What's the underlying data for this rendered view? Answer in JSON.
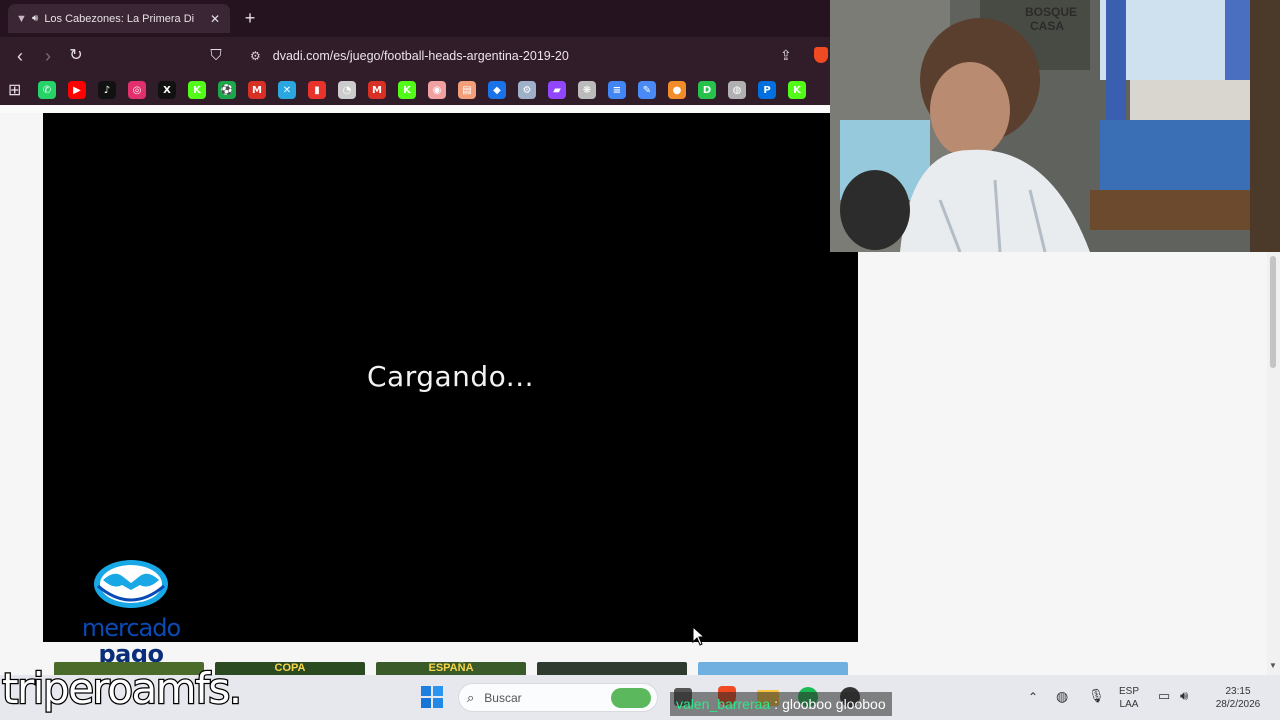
{
  "browser": {
    "tab_title": "Los Cabezones: La Primera Di",
    "new_tab_symbol": "+",
    "close_symbol": "✕",
    "url": "dvadi.com/es/juego/football-heads-argentina-2019-20",
    "bookmarks": [
      {
        "name": "whatsapp",
        "color": "#25d366",
        "glyph": "✆"
      },
      {
        "name": "youtube",
        "color": "#ff0000",
        "glyph": "▶"
      },
      {
        "name": "tiktok",
        "color": "#111111",
        "glyph": "♪"
      },
      {
        "name": "instagram",
        "color": "#e1306c",
        "glyph": "◎"
      },
      {
        "name": "x",
        "color": "#111111",
        "glyph": "X"
      },
      {
        "name": "kick",
        "color": "#53fc18",
        "glyph": "K"
      },
      {
        "name": "soccer",
        "color": "#1aa84b",
        "glyph": "⚽"
      },
      {
        "name": "gmail",
        "color": "#d93025",
        "glyph": "M"
      },
      {
        "name": "tool",
        "color": "#2aa6e0",
        "glyph": "✕"
      },
      {
        "name": "stats",
        "color": "#e8322c",
        "glyph": "▮"
      },
      {
        "name": "speed",
        "color": "#cccccc",
        "glyph": "◔"
      },
      {
        "name": "mail",
        "color": "#d93025",
        "glyph": "M"
      },
      {
        "name": "kick2",
        "color": "#53fc18",
        "glyph": "K"
      },
      {
        "name": "target",
        "color": "#f0a0a0",
        "glyph": "◉"
      },
      {
        "name": "calendar",
        "color": "#f3a07a",
        "glyph": "▤"
      },
      {
        "name": "dropbox",
        "color": "#1a73e8",
        "glyph": "◆"
      },
      {
        "name": "steam",
        "color": "#9fb0c9",
        "glyph": "⚙"
      },
      {
        "name": "twitch",
        "color": "#9146ff",
        "glyph": "▰"
      },
      {
        "name": "chatgpt",
        "color": "#bbbbbb",
        "glyph": "❋"
      },
      {
        "name": "docs",
        "color": "#4285f4",
        "glyph": "≡"
      },
      {
        "name": "pen",
        "color": "#4a8af4",
        "glyph": "✎"
      },
      {
        "name": "ball",
        "color": "#f28c28",
        "glyph": "●"
      },
      {
        "name": "d-app",
        "color": "#27c24c",
        "glyph": "D"
      },
      {
        "name": "globe",
        "color": "#b0b0b0",
        "glyph": "◍"
      },
      {
        "name": "paypal",
        "color": "#0070e0",
        "glyph": "P"
      },
      {
        "name": "kick3",
        "color": "#53fc18",
        "glyph": "K"
      }
    ]
  },
  "game": {
    "loading_text": "Cargando..."
  },
  "ad": {
    "brand_line1": "mercado",
    "brand_line2": "pago"
  },
  "thumbnails": [
    {
      "name": "thumb-1",
      "label": "",
      "color": "#4b6b2a"
    },
    {
      "name": "thumb-copa",
      "label": "COPA",
      "color": "#2b4a22"
    },
    {
      "name": "thumb-espana",
      "label": "ESPAÑA",
      "color": "#3a5a2a"
    },
    {
      "name": "thumb-4",
      "label": "",
      "color": "#2e3b2e"
    },
    {
      "name": "thumb-argentina",
      "label": "",
      "color": "#6fb0e0"
    }
  ],
  "taskbar": {
    "search_placeholder": "Buscar",
    "language_top": "ESP",
    "language_bottom": "LAA",
    "time": "23:15",
    "date": "28/2/2026"
  },
  "stream_overlay": {
    "name": "triperoamfs.",
    "chat_user": "valen_barreraa",
    "chat_separator": ":",
    "chat_message": "glooboo glooboo"
  }
}
